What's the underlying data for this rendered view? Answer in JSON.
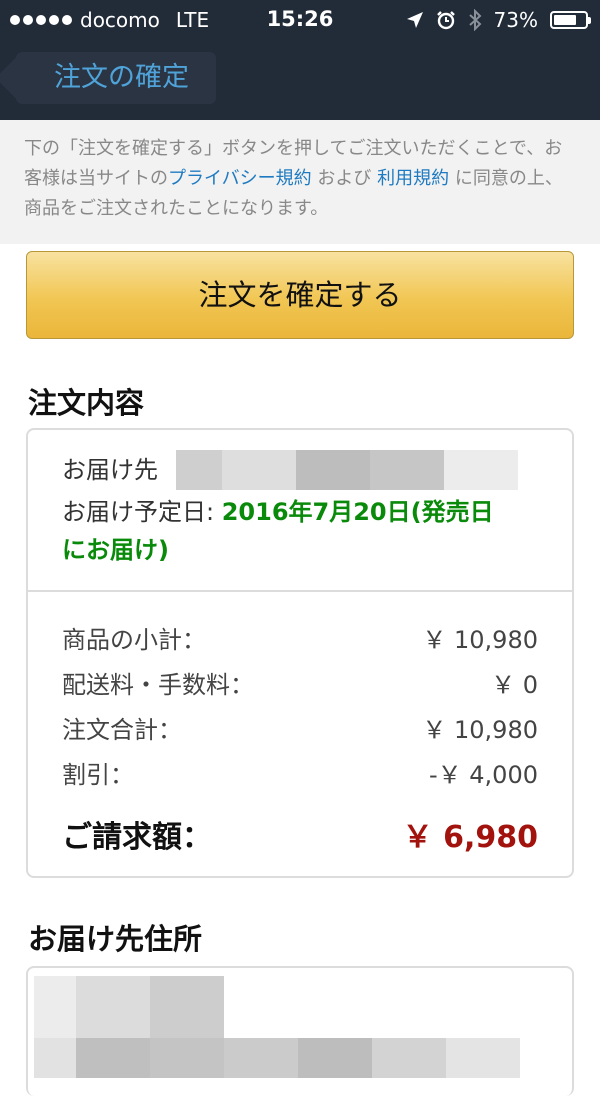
{
  "status_bar": {
    "carrier": "docomo",
    "network": "LTE",
    "time": "15:26",
    "battery_pct": "73%",
    "battery_level": 0.73
  },
  "nav": {
    "back_title": "注文の確定"
  },
  "notice": {
    "part1": "下の「注文を確定する」ボタンを押してご注文いただくことで、お客様は当サイトの",
    "privacy_link": "プライバシー規約",
    "part2": " および ",
    "terms_link": "利用規約",
    "part3": " に同意の上、商品をご注文されたことになります。"
  },
  "confirm_button": {
    "label": "注文を確定する"
  },
  "order": {
    "title": "注文内容",
    "ship_to_label": "お届け先",
    "delivery_date_label": "お届け予定日: ",
    "delivery_date_value_1": "2016年7月20日(発売日",
    "delivery_date_value_2": "にお届け)",
    "summary": [
      {
        "label": "商品の小計：",
        "amount": "￥ 10,980"
      },
      {
        "label": "配送料・手数料：",
        "amount": "￥ 0"
      },
      {
        "label": "注文合計：",
        "amount": "￥ 10,980"
      },
      {
        "label": "割引：",
        "amount": "-￥ 4,000"
      }
    ],
    "total": {
      "label": "ご請求額：",
      "amount": "￥ 6,980"
    }
  },
  "address_section": {
    "title": "お届け先住所"
  },
  "colors": {
    "nav_bg": "#222b38",
    "link": "#1f7bc1",
    "delivery_green": "#0a8a0a",
    "total_red": "#a3130d",
    "button_yellow": "#f1c653"
  }
}
